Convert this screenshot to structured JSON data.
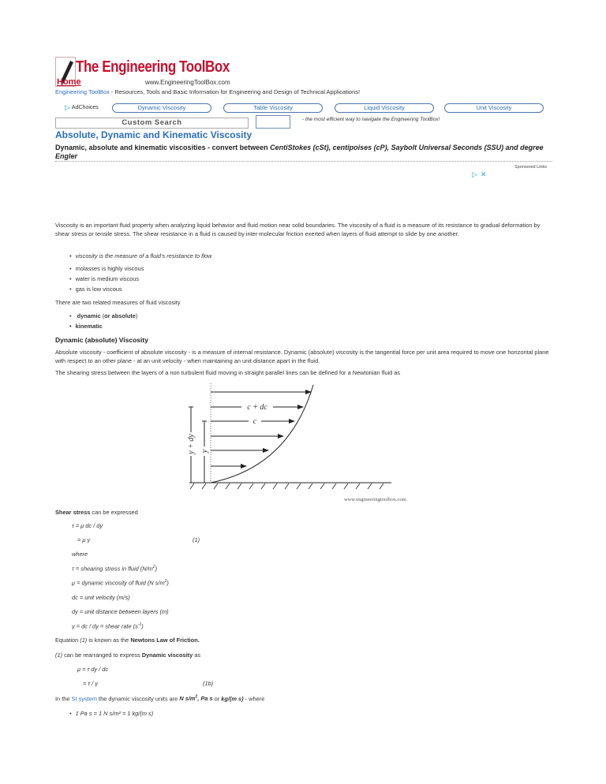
{
  "header": {
    "logo_title": "The Engineering ToolBox",
    "home_label": "Home",
    "logo_url": "www.EngineeringToolBox.com",
    "tagline_link": "Engineering ToolBox",
    "tagline_rest": " - Resources, Tools and Basic Information for Engineering and Design of Technical Applications!"
  },
  "nav": {
    "adchoices": "AdChoices",
    "buttons": [
      "Dynamic Viscosity",
      "Table Viscosity",
      "Liquid Viscosity",
      "Unit Viscosity"
    ],
    "search_placeholder": "Custom Search",
    "hint": "- the most efficient way to navigate the Engineering ToolBox!"
  },
  "article": {
    "title": "Absolute, Dynamic and Kinematic Viscosity",
    "subtitle_plain": "Dynamic, absolute and kinematic viscosities - convert between ",
    "subtitle_italic": "CentiStokes (cSt), centipoises (cP), Saybolt Universal Seconds (SSU) and degree Engler",
    "sponsored": "Sponsored Links",
    "intro": "Viscosity is an important fluid property when analyzing liquid behavior and fluid motion near solid boundaries. The viscosity of a fluid is a measure of its resistance to gradual deformation by shear stress or tensile stress. The shear resistance in a fluid is caused by inter-molecular friction exerted when layers of fluid attempt to slide by one another.",
    "definition_bullet": "viscosity is the measure of a fluid's resistance to flow",
    "examples": [
      "molasses is highly viscous",
      "water is medium viscous",
      "gas is low viscous"
    ],
    "measures_intro": "There are two related measures of fluid viscosity",
    "measures": [
      "dynamic",
      "or absolute",
      "kinematic"
    ],
    "section_title": "Dynamic (absolute) Viscosity",
    "section_text": "Absolute viscosity - coefficient of absolute viscosity - is a measure of internal resistance. Dynamic (absolute) viscosity is the tangential force per unit area required to move one horizontal plane with respect to an other plane - at an unit velocity - when maintaining an unit distance apart in the fluid.",
    "shear_intro": "The shearing stress between the layers of a non turbulent fluid moving in straight parallel lines can be defined for a Newtonian fluid as",
    "diagram": {
      "label_c_dc": "c + dc",
      "label_c": "c",
      "label_y_dy": "y + dy",
      "label_y": "y",
      "watermark": "www.engineeringtoolbox.com"
    },
    "shear_stress_bold": "Shear stress",
    "shear_stress_rest": " can be expressed",
    "eq1a": "τ = μ dc / dy",
    "eq1b": "= μ γ",
    "eq1_num": "(1)",
    "where": "where",
    "defs": [
      "τ = shearing stress in fluid (N/m",
      "μ = dynamic viscosity of fluid (N s/m",
      "dc = unit velocity (m/s)",
      "dy = unit distance between layers (m)",
      "γ = dc / dy = shear rate (s"
    ],
    "sup2": "2",
    "supneg1": "-1",
    "close_paren": ")",
    "law_pre": "Equation ",
    "law_ref": "(1)",
    "law_mid": " is known as the ",
    "law_bold": "Newtons Law of Friction.",
    "rearr_ref": "(1)",
    "rearr_mid": " can be rearranged to express ",
    "rearr_bold": "Dynamic viscosity",
    "rearr_end": " as",
    "eq1b_a": "μ = τ dy / dc",
    "eq1b_b": "= τ  / γ",
    "eq1b_num": "(1b)",
    "si_pre": "In the ",
    "si_link": "SI system",
    "si_mid": " the dynamic viscosity units are ",
    "si_units1": "N s/m",
    "si_units2": ", Pa s",
    "si_or": " or ",
    "si_units3": "kg/(m s)",
    "si_end": " - where",
    "si_bullet": "1 Pa s = 1 N s/m² = 1 kg/(m s)"
  }
}
